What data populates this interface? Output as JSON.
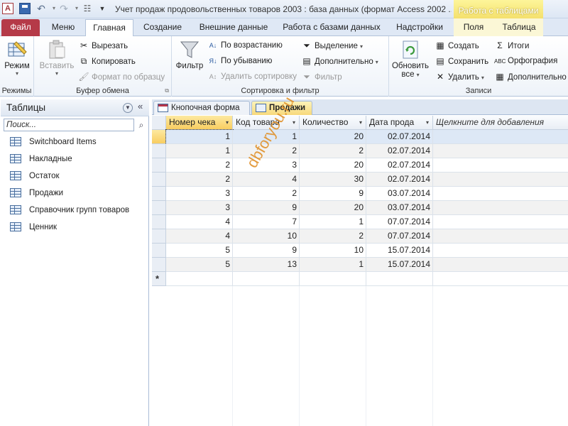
{
  "window": {
    "title": "Учет продаж продовольственных товаров 2003 : база данных (формат Access 2002 ...",
    "context_tab_group": "Работа с таблицами"
  },
  "ribbon_tabs": [
    {
      "label": "Файл"
    },
    {
      "label": "Меню"
    },
    {
      "label": "Главная"
    },
    {
      "label": "Создание"
    },
    {
      "label": "Внешние данные"
    },
    {
      "label": "Работа с базами данных"
    },
    {
      "label": "Надстройки"
    },
    {
      "label": "Поля"
    },
    {
      "label": "Таблица"
    }
  ],
  "active_tab": "Главная",
  "ribbon": {
    "modes": {
      "label": "Режимы",
      "view": "Режим"
    },
    "clipboard": {
      "label": "Буфер обмена",
      "paste": "Вставить",
      "cut": "Вырезать",
      "copy": "Копировать",
      "format_painter": "Формат по образцу"
    },
    "sort_filter": {
      "label": "Сортировка и фильтр",
      "filter": "Фильтр",
      "ascending": "По возрастанию",
      "descending": "По убыванию",
      "remove_sort": "Удалить сортировку",
      "selection": "Выделение",
      "advanced": "Дополнительно",
      "toggle_filter": "Фильтр"
    },
    "records": {
      "label": "Записи",
      "refresh": "Обновить",
      "refresh_all": "все",
      "new": "Создать",
      "save": "Сохранить",
      "delete": "Удалить",
      "totals": "Итоги",
      "spelling": "Орфография",
      "more": "Дополнительно"
    }
  },
  "nav_pane": {
    "title": "Таблицы",
    "search_placeholder": "Поиск...",
    "items": [
      {
        "label": "Switchboard Items"
      },
      {
        "label": "Накладные"
      },
      {
        "label": "Остаток"
      },
      {
        "label": "Продажи"
      },
      {
        "label": "Справочник групп товаров"
      },
      {
        "label": "Ценник"
      }
    ]
  },
  "doc_tabs": [
    {
      "label": "Кнопочная форма",
      "active": false
    },
    {
      "label": "Продажи",
      "active": true
    }
  ],
  "datasheet": {
    "columns": [
      "Номер чека",
      "Код товара",
      "Количество",
      "Дата прода",
      "Щелкните для добавления"
    ],
    "rows": [
      [
        "1",
        "1",
        "20",
        "02.07.2014"
      ],
      [
        "1",
        "2",
        "2",
        "02.07.2014"
      ],
      [
        "2",
        "3",
        "20",
        "02.07.2014"
      ],
      [
        "2",
        "4",
        "30",
        "02.07.2014"
      ],
      [
        "3",
        "2",
        "9",
        "03.07.2014"
      ],
      [
        "3",
        "9",
        "20",
        "03.07.2014"
      ],
      [
        "4",
        "7",
        "1",
        "07.07.2014"
      ],
      [
        "4",
        "10",
        "2",
        "07.07.2014"
      ],
      [
        "5",
        "9",
        "10",
        "15.07.2014"
      ],
      [
        "5",
        "13",
        "1",
        "15.07.2014"
      ]
    ],
    "new_row_marker": "*"
  },
  "watermark": "dbforyou.ru"
}
